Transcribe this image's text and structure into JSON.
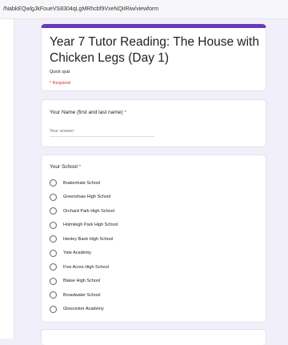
{
  "browser": {
    "url_fragment": "/NabkEQwlgJkFoueVS8304qLgMRhcbf9VxeNQiIRiw/viewform"
  },
  "form": {
    "title": "Year 7 Tutor Reading: The House with Chicken Legs (Day 1)",
    "description": "Quick quiz",
    "required_note": "* Required"
  },
  "questions": {
    "name": {
      "title": "Your Name (first and last name)",
      "required_marker": "*",
      "placeholder": "Your answer"
    },
    "school": {
      "title": "Your School",
      "required_marker": "*",
      "options": [
        "Brakenhale School",
        "Greenshaw High School",
        "Orchard Park High School",
        "Holmleigh Park High School",
        "Henley Bank High School",
        "Yate Academy",
        "Five Acres High School",
        "Blaise High School",
        "Broadwater School",
        "Gloucester Academy"
      ]
    }
  },
  "colors": {
    "accent": "#673ab7",
    "required": "#d93025",
    "background": "#f1effa"
  }
}
